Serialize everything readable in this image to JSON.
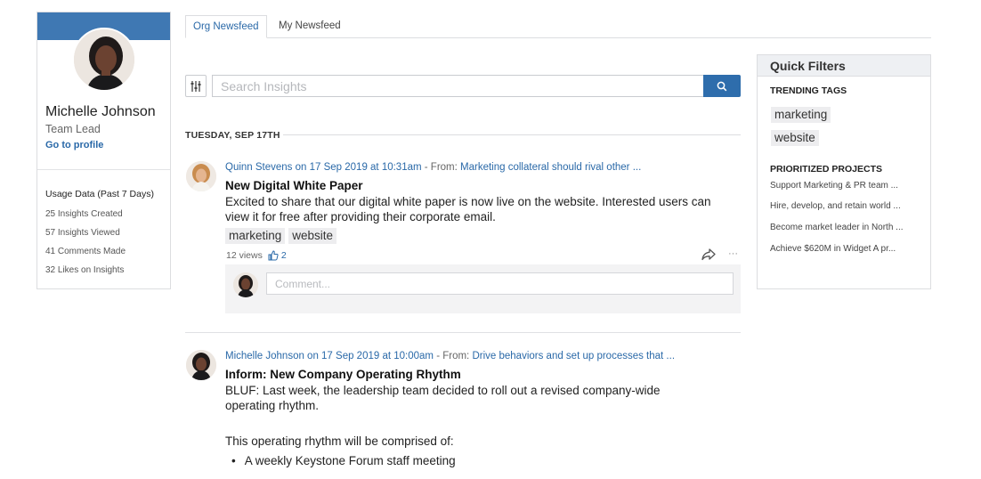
{
  "profile": {
    "name": "Michelle Johnson",
    "role": "Team Lead",
    "link": "Go to profile",
    "usage_title": "Usage Data (Past 7 Days)",
    "usage": [
      "25 Insights Created",
      "57 Insights Viewed",
      "41 Comments Made",
      "32 Likes on Insights"
    ]
  },
  "tabs": [
    {
      "label": "Org Newsfeed",
      "active": true
    },
    {
      "label": "My Newsfeed",
      "active": false
    }
  ],
  "search": {
    "placeholder": "Search Insights"
  },
  "date_header": "TUESDAY, SEP 17TH",
  "posts": [
    {
      "author_line": "Quinn Stevens on 17 Sep 2019 at 10:31am",
      "from_label": " - From: ",
      "from_project": "Marketing collateral should rival other ...",
      "title": "New Digital White Paper",
      "body": "Excited to share that our digital white paper is now live on the website. Interested users can view it for free after providing their corporate email.",
      "tags": [
        "marketing",
        "website"
      ],
      "views": "12 views",
      "likes": "2",
      "comment_placeholder": "Comment..."
    },
    {
      "author_line": "Michelle Johnson on 17 Sep 2019 at 10:00am",
      "from_label": " - From: ",
      "from_project": "Drive behaviors and set up processes that ...",
      "title": "Inform: New Company Operating Rhythm",
      "body": "BLUF: Last week, the leadership team decided to roll out a revised company-wide operating rhythm.",
      "body2": "This operating rhythm will be comprised of:",
      "bullets": [
        "A weekly Keystone Forum staff meeting"
      ]
    }
  ],
  "quick_filters": {
    "title": "Quick Filters",
    "trending_title": "TRENDING TAGS",
    "trending_tags": [
      "marketing",
      "website"
    ],
    "projects_title": "PRIORITIZED PROJECTS",
    "projects": [
      "Support Marketing & PR team ...",
      "Hire, develop, and retain world ...",
      "Become market leader in North ...",
      "Achieve $620M in Widget A pr..."
    ]
  },
  "colors": {
    "accent": "#2a69a8",
    "banner": "#3f78b3",
    "search_button": "#2e6dac"
  },
  "icons": [
    "filter-sliders-icon",
    "search-icon",
    "thumbs-up-icon",
    "share-icon",
    "more-icon"
  ]
}
